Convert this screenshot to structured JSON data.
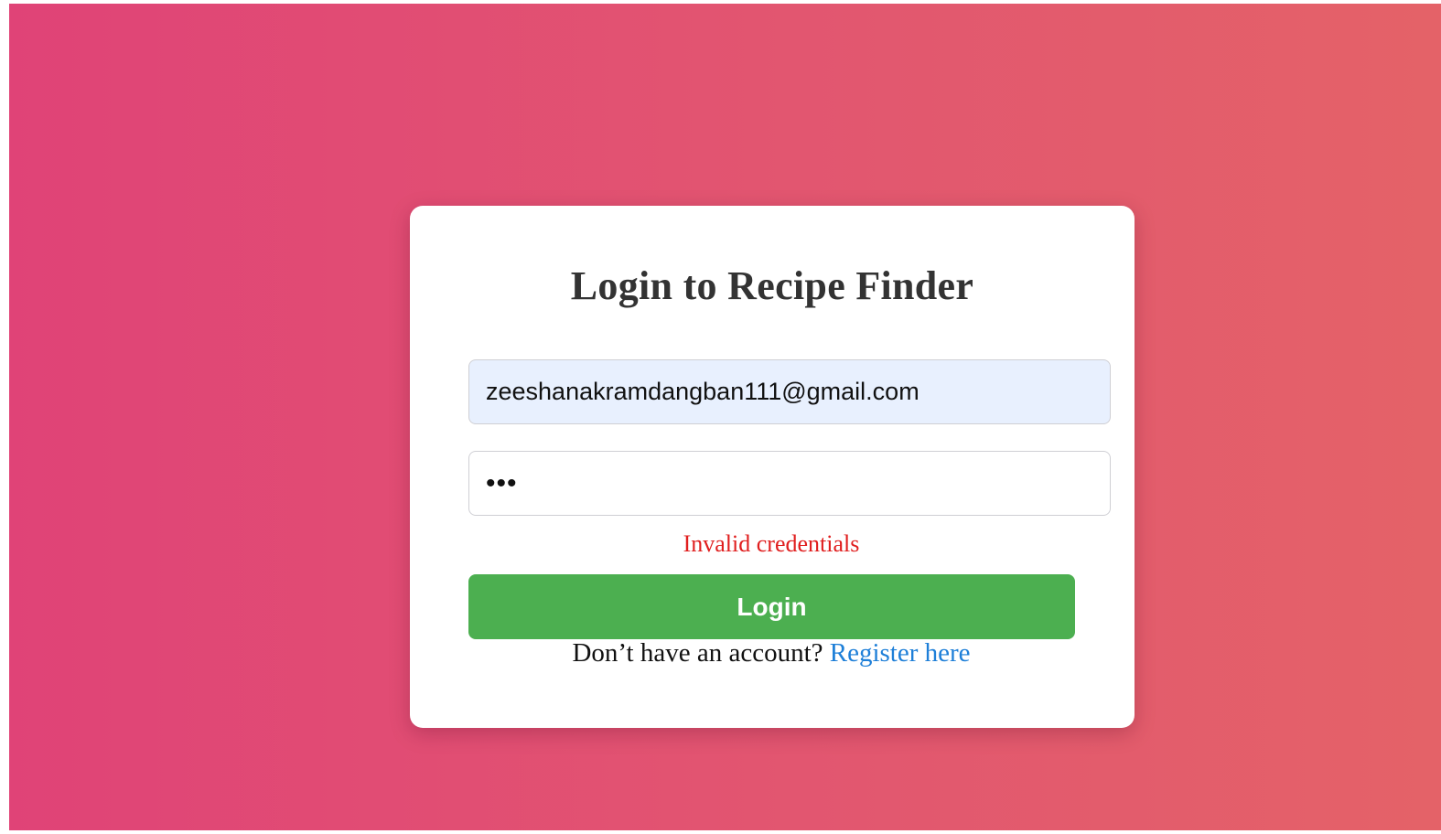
{
  "login_form": {
    "title": "Login to Recipe Finder",
    "email_value": "zeeshanakramdangban111@gmail.com",
    "password_value": "•••",
    "error_message": "Invalid credentials",
    "submit_label": "Login",
    "register_prompt": "Don’t have an account?",
    "register_link_label": "Register here"
  },
  "colors": {
    "background_gradient_start": "#e04377",
    "background_gradient_end": "#e46268",
    "submit_button": "#4caf50",
    "error_text": "#e01e1e",
    "link": "#1e7fd8",
    "autofill_field": "#e8f0fe"
  }
}
